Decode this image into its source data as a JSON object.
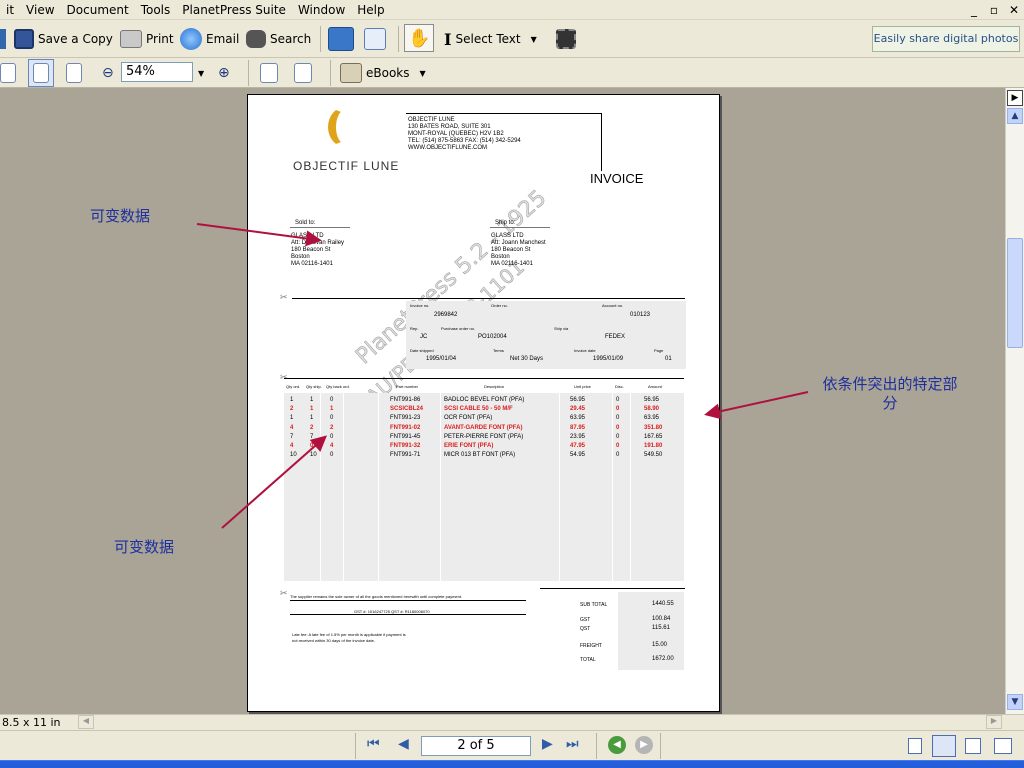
{
  "menu": [
    "it",
    "View",
    "Document",
    "Tools",
    "PlanetPress Suite",
    "Window",
    "Help"
  ],
  "window_controls": [
    "_",
    "▫",
    "✕"
  ],
  "toolbar1": {
    "save_copy": "Save a Copy",
    "print": "Print",
    "email": "Email",
    "search": "Search",
    "select_text": "Select Text",
    "ad": "Easily share digital photos"
  },
  "toolbar2": {
    "zoom": "54%",
    "ebooks": "eBooks"
  },
  "status": {
    "page_size": "8.5 x 11 in"
  },
  "nav": {
    "page_indicator": "2 of 5"
  },
  "annotations": {
    "variable_data_1": "可变数据",
    "variable_data_2": "可变数据",
    "highlight": "依条件突出的特定部分"
  },
  "invoice": {
    "brand": "OBJECTIF LUNE",
    "address": [
      "OBJECTIF LUNE",
      "130 BATES ROAD, SUITE 301",
      "MONT-ROYAL (QUEBEC) H2V 1B2",
      "TEL: (514) 875-5863 FAX: (514) 342-5294",
      "WWW.OBJECTIFLUNE.COM"
    ],
    "title": "INVOICE",
    "sold_to_label": "Sold to:",
    "sold_to": [
      "GLASS LTD",
      "Att: Donovan Railey",
      "180 Beacon St",
      "Boston",
      "MA 02116-1401"
    ],
    "ship_to_label": "Ship to:",
    "ship_to": [
      "GLASS LTD",
      "Att: Joann Manchest",
      "180 Beacon St",
      "Boston",
      "MA 02116-1401"
    ],
    "watermark": "PlanetPress 5.2 - 1925",
    "watermark2": "AU/PD-551078-1101",
    "labels": {
      "invoice_no": "Invoice no.",
      "order_no": "Order no.",
      "account_no": "Account no.",
      "rep": "Rep.",
      "po": "Purchase order no.",
      "ship_via": "Ship via",
      "date_shipped": "Date shipped",
      "terms": "Terms",
      "invoice_date": "Invoice date",
      "page": "Page"
    },
    "values": {
      "invoice_no": "2969842",
      "account_no": "010123",
      "rep": "JC",
      "po": "PO102004",
      "ship_via": "FEDEX",
      "date_shipped": "1995/01/04",
      "terms": "Net 30 Days",
      "invoice_date": "1995/01/09",
      "page": "01"
    },
    "columns": [
      "Qty ord.",
      "Qty ship.",
      "Qty back ord.",
      "Part number",
      "Description",
      "Unit price",
      "Disc.",
      "Amount"
    ],
    "rows": [
      {
        "qo": "1",
        "qs": "1",
        "qb": "0",
        "part": "FNT991-86",
        "desc": "BADLOC BEVEL FONT (PFA)",
        "price": "56.95",
        "disc": "0",
        "amount": "56.95",
        "hl": false
      },
      {
        "qo": "2",
        "qs": "1",
        "qb": "1",
        "part": "SCSICBL24",
        "desc": "SCSI CABLE 50 - 50 M/F",
        "price": "29.45",
        "disc": "0",
        "amount": "58.90",
        "hl": true
      },
      {
        "qo": "1",
        "qs": "1",
        "qb": "0",
        "part": "FNT991-23",
        "desc": "OCR FONT (PFA)",
        "price": "63.95",
        "disc": "0",
        "amount": "63.95",
        "hl": false
      },
      {
        "qo": "4",
        "qs": "2",
        "qb": "2",
        "part": "FNT991-02",
        "desc": "AVANT-GARDE FONT (PFA)",
        "price": "87.95",
        "disc": "0",
        "amount": "351.80",
        "hl": true
      },
      {
        "qo": "7",
        "qs": "7",
        "qb": "0",
        "part": "FNT991-45",
        "desc": "PETER-PIERRE FONT (PFA)",
        "price": "23.95",
        "disc": "0",
        "amount": "167.65",
        "hl": false
      },
      {
        "qo": "4",
        "qs": "0",
        "qb": "4",
        "part": "FNT991-32",
        "desc": "ERIE FONT (PFA)",
        "price": "47.95",
        "disc": "0",
        "amount": "191.80",
        "hl": true
      },
      {
        "qo": "10",
        "qs": "10",
        "qb": "0",
        "part": "FNT991-71",
        "desc": "MICR 013 BT FONT (PFA)",
        "price": "54.95",
        "disc": "0",
        "amount": "549.50",
        "hl": false
      }
    ],
    "footer_note": "The supplier remains the sole owner of all the goods mentioned herewith until complete payment.",
    "gst_line": "GST #: 1016247725        QST #: R1160006070",
    "late_fee": [
      "Late fee: A late fee of 1.5% per month is applicable if payment is",
      "not received within 30 days of the invoice date."
    ],
    "totals": [
      {
        "label": "SUB TOTAL",
        "value": "1440.55"
      },
      {
        "label": "GST",
        "value": "100.84"
      },
      {
        "label": "QST",
        "value": "115.61"
      },
      {
        "label": "FREIGHT",
        "value": "15.00"
      },
      {
        "label": "TOTAL",
        "value": "1672.00"
      }
    ]
  }
}
